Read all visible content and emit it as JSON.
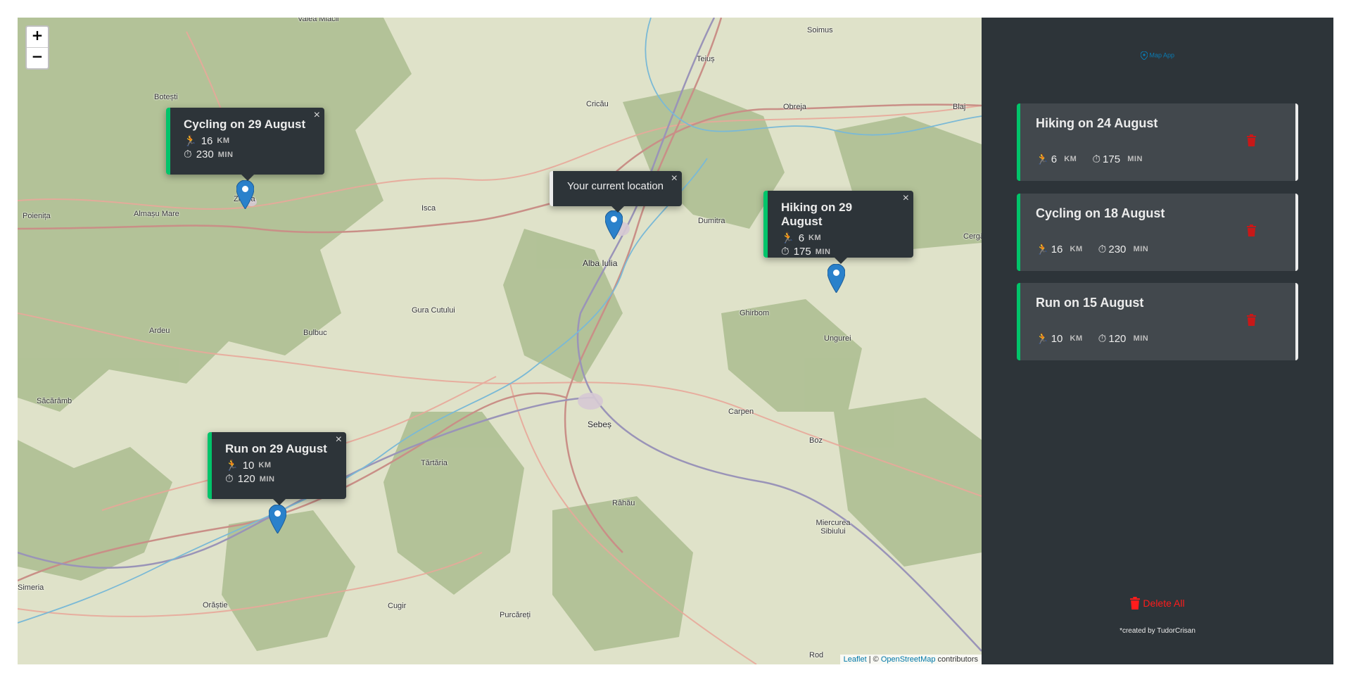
{
  "map": {
    "zoom_in": "+",
    "zoom_out": "−",
    "places": [
      {
        "name": "Valea Mlacii"
      },
      {
        "name": "Soimus"
      },
      {
        "name": "Teiuș"
      },
      {
        "name": "Botești"
      },
      {
        "name": "Cricău"
      },
      {
        "name": "Obreja"
      },
      {
        "name": "Blaj"
      },
      {
        "name": "Zlatna"
      },
      {
        "name": "Poienița"
      },
      {
        "name": "Almașu Mare"
      },
      {
        "name": "Isca"
      },
      {
        "name": "Dumitra"
      },
      {
        "name": "Cergău Mic"
      },
      {
        "name": "Alba Iulia"
      },
      {
        "name": "Ghirbom"
      },
      {
        "name": "Gura Cutului"
      },
      {
        "name": "Ardeu"
      },
      {
        "name": "Bulbuc"
      },
      {
        "name": "Ungurei"
      },
      {
        "name": "Săcărâmb"
      },
      {
        "name": "Sebeș"
      },
      {
        "name": "Carpen"
      },
      {
        "name": "Boz"
      },
      {
        "name": "Tărtăria"
      },
      {
        "name": "Râhău"
      },
      {
        "name": "Miercurea Sibiului"
      },
      {
        "name": "Simeria"
      },
      {
        "name": "Orăștie"
      },
      {
        "name": "Cugir"
      },
      {
        "name": "Purcăreți"
      },
      {
        "name": "Rod"
      }
    ],
    "popups": {
      "cycling": {
        "title": "Cycling on 29 August",
        "distance": "16",
        "distance_unit": "KM",
        "duration": "230",
        "duration_unit": "MIN",
        "close": "×"
      },
      "current": {
        "title": "Your current location",
        "close": "×"
      },
      "hiking": {
        "title": "Hiking on 29 August",
        "distance": "6",
        "distance_unit": "KM",
        "duration": "175",
        "duration_unit": "MIN",
        "close": "×"
      },
      "run": {
        "title": "Run on 29 August",
        "distance": "10",
        "distance_unit": "KM",
        "duration": "120",
        "duration_unit": "MIN",
        "close": "×"
      }
    },
    "attribution": {
      "leaflet": "Leaflet",
      "sep": " | © ",
      "osm": "OpenStreetMap",
      "contrib": " contributors"
    }
  },
  "sidebar": {
    "logo_text": "Map App",
    "workouts": [
      {
        "title": "Hiking on 24 August",
        "distance": "6",
        "distance_unit": "KM",
        "duration": "175",
        "duration_unit": "MIN"
      },
      {
        "title": "Cycling on 18 August",
        "distance": "16",
        "distance_unit": "KM",
        "duration": "230",
        "duration_unit": "MIN"
      },
      {
        "title": "Run on 15 August",
        "distance": "10",
        "distance_unit": "KM",
        "duration": "120",
        "duration_unit": "MIN"
      }
    ],
    "delete_all": "Delete All",
    "credit": "*created by TudorCrisan"
  },
  "colors": {
    "accent": "#00c46a",
    "sidebar_bg": "#2d3439",
    "card_bg": "#42484d",
    "danger": "#ff1c1c",
    "marker": "#2a81cb"
  }
}
